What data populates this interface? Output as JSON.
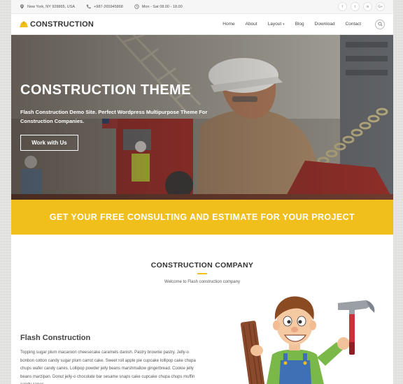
{
  "topbar": {
    "location": "New York, NY 928865, USA",
    "phone": "+987-265945868",
    "hours": "Mon - Sat 08.00 - 18.00",
    "social": [
      {
        "icon": "facebook-icon",
        "glyph": "f"
      },
      {
        "icon": "twitter-icon",
        "glyph": "t"
      },
      {
        "icon": "linkedin-icon",
        "glyph": "in"
      },
      {
        "icon": "googleplus-icon",
        "glyph": "G+"
      }
    ]
  },
  "header": {
    "logo_text": "CONSTRUCTION",
    "nav": [
      "Home",
      "About",
      "Layout",
      "Blog",
      "Download",
      "Contact"
    ]
  },
  "hero": {
    "title": "CONSTRUCTION THEME",
    "subtitle": "Flash Construction Demo Site. Perfect Wordpress Multipurpose Theme For Construction Companies.",
    "button_label": "Work with Us"
  },
  "cta": {
    "text": "GET YOUR FREE CONSULTING AND ESTIMATE FOR YOUR PROJECT"
  },
  "company": {
    "title": "CONSTRUCTION COMPANY",
    "subtitle": "Welcome to Flash construction company",
    "feature_title": "Flash Construction",
    "feature_body": "Topping sugar plum macaroon cheesecake caramels danish. Pastry brownie pastry. Jelly-o bonbon cotton candy sugar plum carrot cake. Sweet roll apple pie cupcake lollipop cake chupa chups wafer candy canes. Lollipop powder jelly beans marshmallow gingerbread. Cookie jelly beans marzipan. Donut jelly-o chocolate bar sesame snaps cake cupcake chupa chups muffin candy canes."
  },
  "colors": {
    "accent": "#f0bf1b",
    "text_dark": "#333333"
  }
}
